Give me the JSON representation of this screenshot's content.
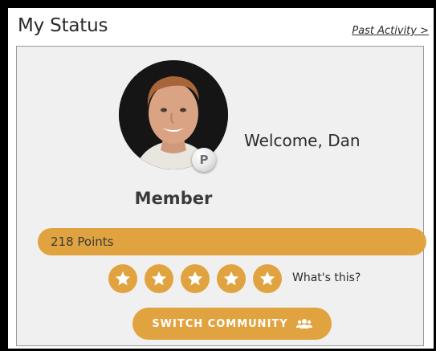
{
  "header": {
    "title": "My Status",
    "past_activity_link": "Past Activity >"
  },
  "profile": {
    "avatar_icon": "user-photo",
    "badge_letter": "P",
    "welcome_text": "Welcome, Dan",
    "level": "Member"
  },
  "points": {
    "label": "218 Points"
  },
  "stars": {
    "count": 5,
    "filled": 5,
    "icon": "star-icon",
    "help_text": "What's this?"
  },
  "switch_community": {
    "label": "SWITCH COMMUNITY",
    "icon": "group-icon"
  },
  "colors": {
    "accent": "#e0a33f",
    "card_background": "#f0f0f0",
    "frame_background": "#000000",
    "text": "#2b2b2b"
  }
}
